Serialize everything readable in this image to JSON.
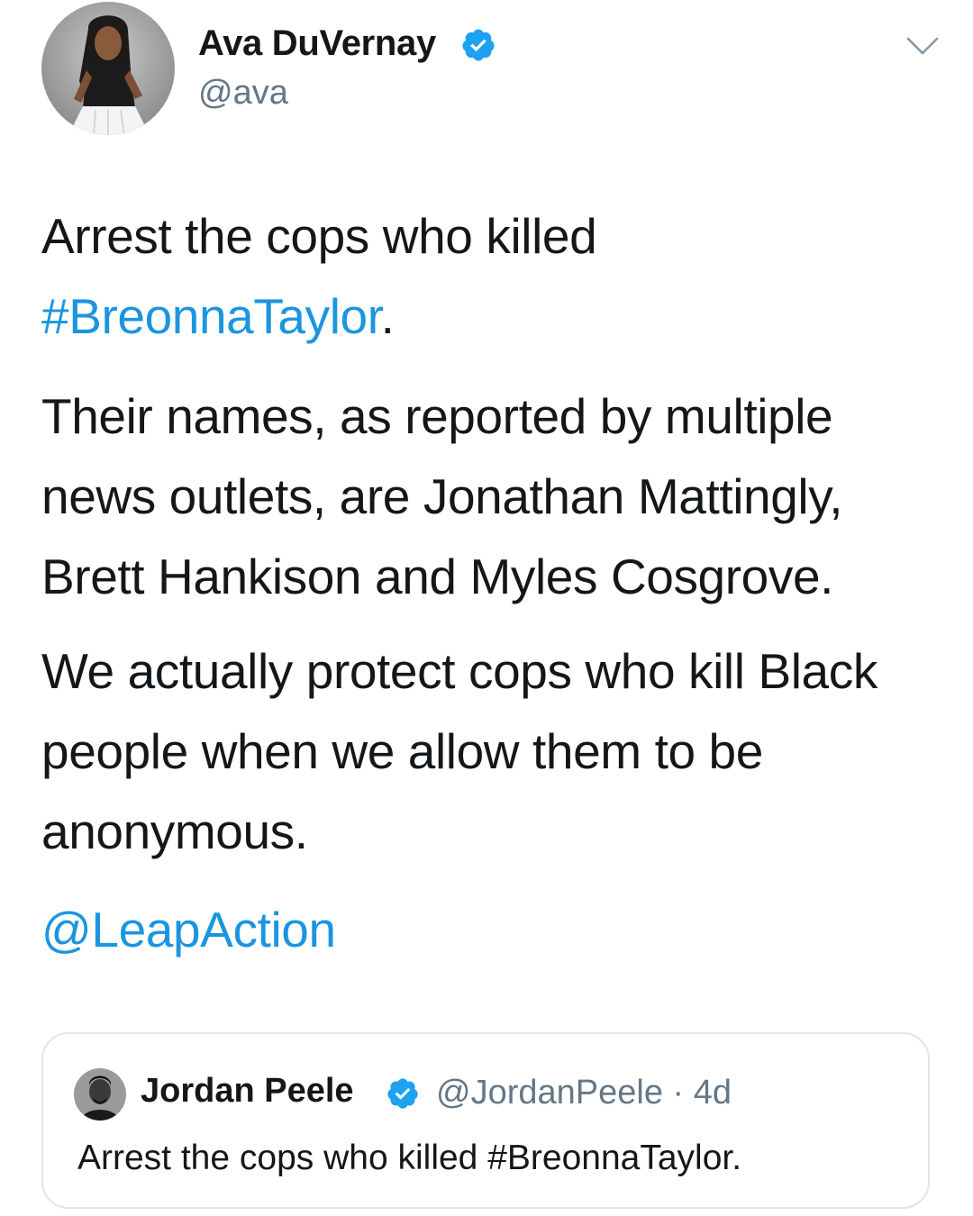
{
  "tweet": {
    "author_name": "Ava DuVernay",
    "author_handle": "@ava",
    "paragraphs": {
      "p1_text": "Arrest the cops who killed ",
      "p1_hashtag": "#BreonnaTaylor",
      "p1_end": ".",
      "p2": "Their names, as reported by multiple news outlets, are Jonathan Mattingly, Brett Hankison and Myles Cosgrove.",
      "p3": "We actually protect cops who kill Black people when we allow them to be anonymous.",
      "p4_mention": "@LeapAction"
    }
  },
  "quoted": {
    "author_name": "Jordan Peele",
    "author_handle": "@JordanPeele",
    "separator": "·",
    "age": "4d",
    "text": "Arrest the cops who killed #BreonnaTaylor."
  },
  "colors": {
    "link": "#1b95e0",
    "verified": "#1da1f2",
    "secondary_text": "#657786",
    "border": "#dfe5ea"
  },
  "icons": {
    "verified": "verified-badge-icon",
    "menu": "chevron-down-icon"
  }
}
